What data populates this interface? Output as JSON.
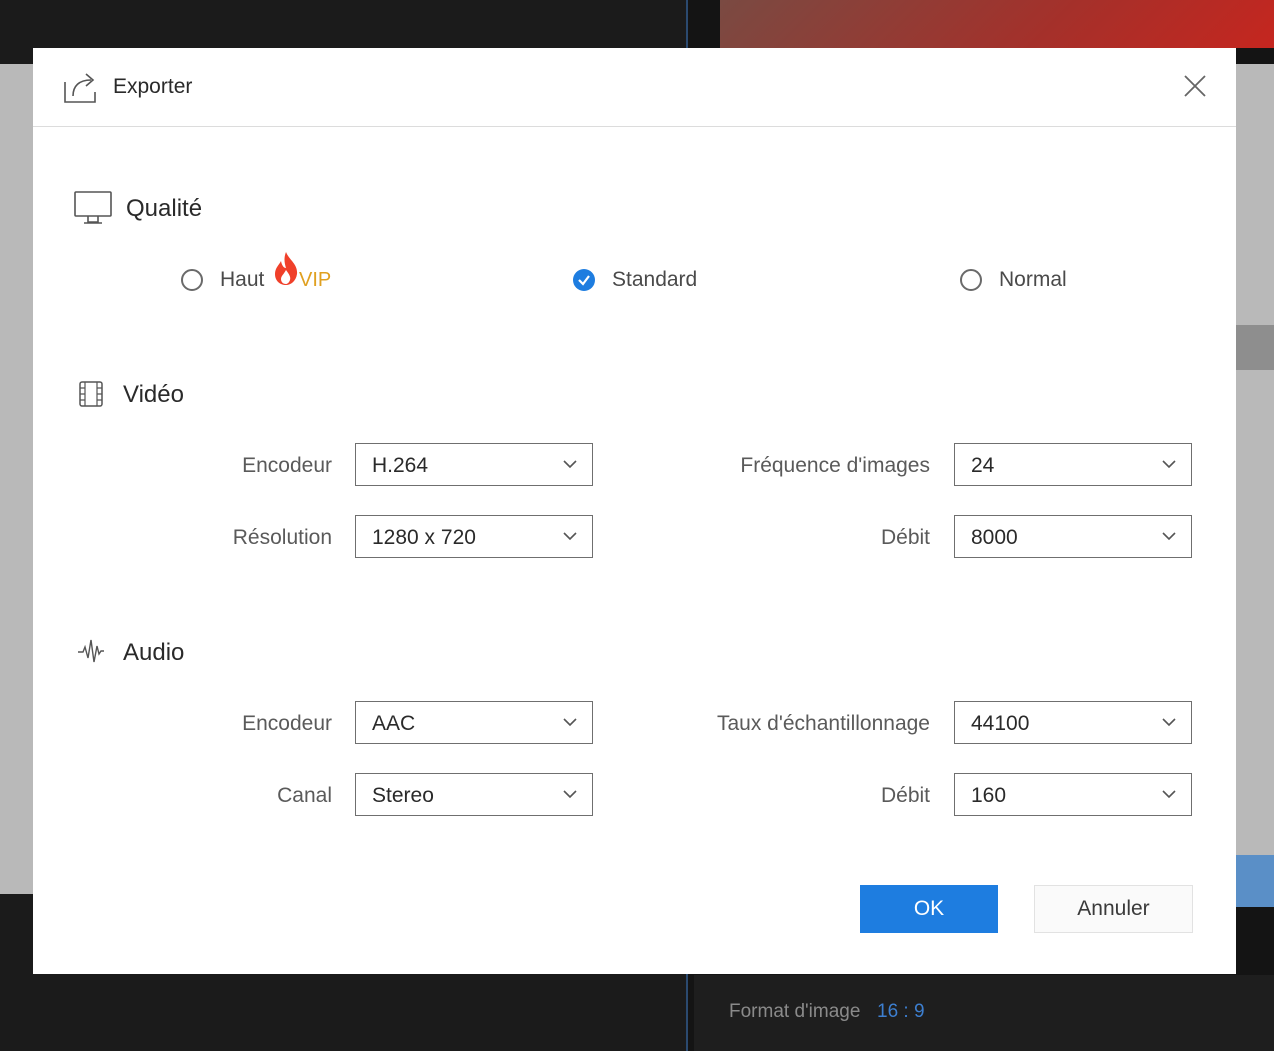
{
  "background": {
    "footer_label": "Format d'image",
    "footer_value": "16 : 9"
  },
  "dialog": {
    "title": "Exporter",
    "quality": {
      "title": "Qualité",
      "options": [
        {
          "label": "Haut",
          "checked": false,
          "badge": "VIP"
        },
        {
          "label": "Standard",
          "checked": true
        },
        {
          "label": "Normal",
          "checked": false
        }
      ]
    },
    "video": {
      "title": "Vidéo",
      "encoder_label": "Encodeur",
      "encoder_value": "H.264",
      "resolution_label": "Résolution",
      "resolution_value": "1280 x 720",
      "framerate_label": "Fréquence d'images",
      "framerate_value": "24",
      "bitrate_label": "Débit",
      "bitrate_value": "8000"
    },
    "audio": {
      "title": "Audio",
      "encoder_label": "Encodeur",
      "encoder_value": "AAC",
      "channel_label": "Canal",
      "channel_value": "Stereo",
      "samplerate_label": "Taux d'échantillonnage",
      "samplerate_value": "44100",
      "bitrate_label": "Débit",
      "bitrate_value": "160"
    },
    "ok_label": "OK",
    "cancel_label": "Annuler"
  },
  "colors": {
    "accent": "#1e7de0",
    "vip": "#e0a020",
    "fire": "#f0402a"
  }
}
